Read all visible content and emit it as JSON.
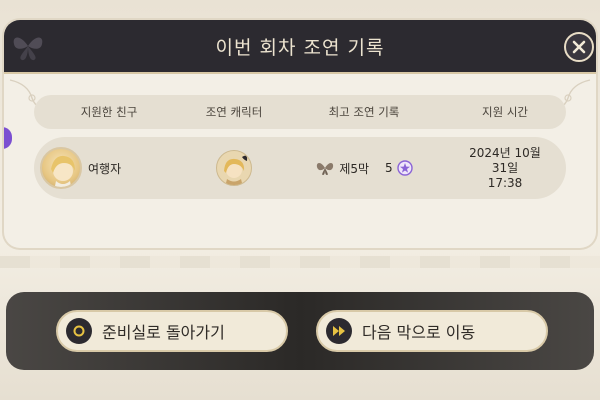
{
  "dialog": {
    "title": "이번 회차 조연 기록"
  },
  "table": {
    "headers": [
      "지원한 친구",
      "조연 캐릭터",
      "최고 조연 기록",
      "지원 시간"
    ],
    "rows": [
      {
        "friend": "여행자",
        "record_act": "제5막",
        "record_count": "5",
        "time_line1": "2024년 10월",
        "time_line2": "31일",
        "time_line3": "17:38"
      }
    ]
  },
  "buttons": {
    "back_label": "준비실로 돌아가기",
    "next_label": "다음 막으로 이동"
  },
  "colors": {
    "header_bg": "#2c2a30",
    "panel_bg": "#f3efe6",
    "accent_purple": "#7b4fd1",
    "button_icon_gold": "#e7c243"
  }
}
